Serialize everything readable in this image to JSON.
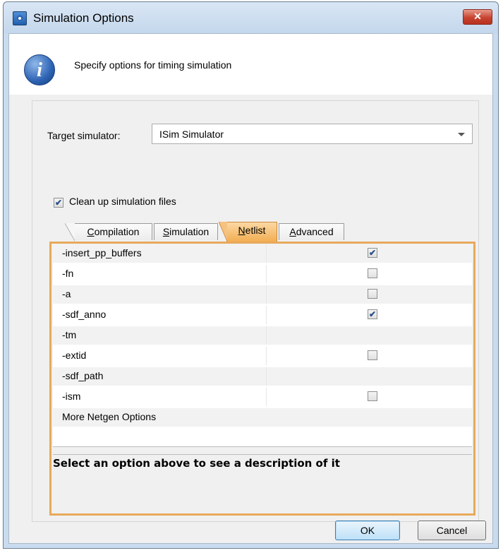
{
  "window": {
    "title": "Simulation Options",
    "close_label": "✕"
  },
  "header": {
    "text": "Specify options for timing simulation"
  },
  "form": {
    "target_label": "Target simulator:",
    "target_value": "ISim Simulator",
    "cleanup_label": "Clean up simulation files",
    "cleanup_checked": true
  },
  "tabs": [
    {
      "pre": "",
      "u": "C",
      "post": "ompilation",
      "active": false
    },
    {
      "pre": "",
      "u": "S",
      "post": "imulation",
      "active": false
    },
    {
      "pre": "",
      "u": "N",
      "post": "etlist",
      "active": true
    },
    {
      "pre": "",
      "u": "A",
      "post": "dvanced",
      "active": false
    }
  ],
  "options": [
    {
      "name": "-insert_pp_buffers",
      "checkbox": true,
      "checked": true
    },
    {
      "name": "-fn",
      "checkbox": true,
      "checked": false
    },
    {
      "name": "-a",
      "checkbox": true,
      "checked": false
    },
    {
      "name": "-sdf_anno",
      "checkbox": true,
      "checked": true
    },
    {
      "name": "-tm",
      "checkbox": false,
      "checked": false
    },
    {
      "name": "-extid",
      "checkbox": true,
      "checked": false
    },
    {
      "name": "-sdf_path",
      "checkbox": false,
      "checked": false
    },
    {
      "name": "-ism",
      "checkbox": true,
      "checked": false
    },
    {
      "name": "More Netgen Options",
      "checkbox": false,
      "checked": false
    }
  ],
  "description": "Select an option above to see a description of it",
  "buttons": {
    "ok": "OK",
    "cancel": "Cancel"
  },
  "colors": {
    "active_tab": "#f2ae53",
    "panel_border": "#e8a95b",
    "titlebar": "#c9dbee"
  }
}
